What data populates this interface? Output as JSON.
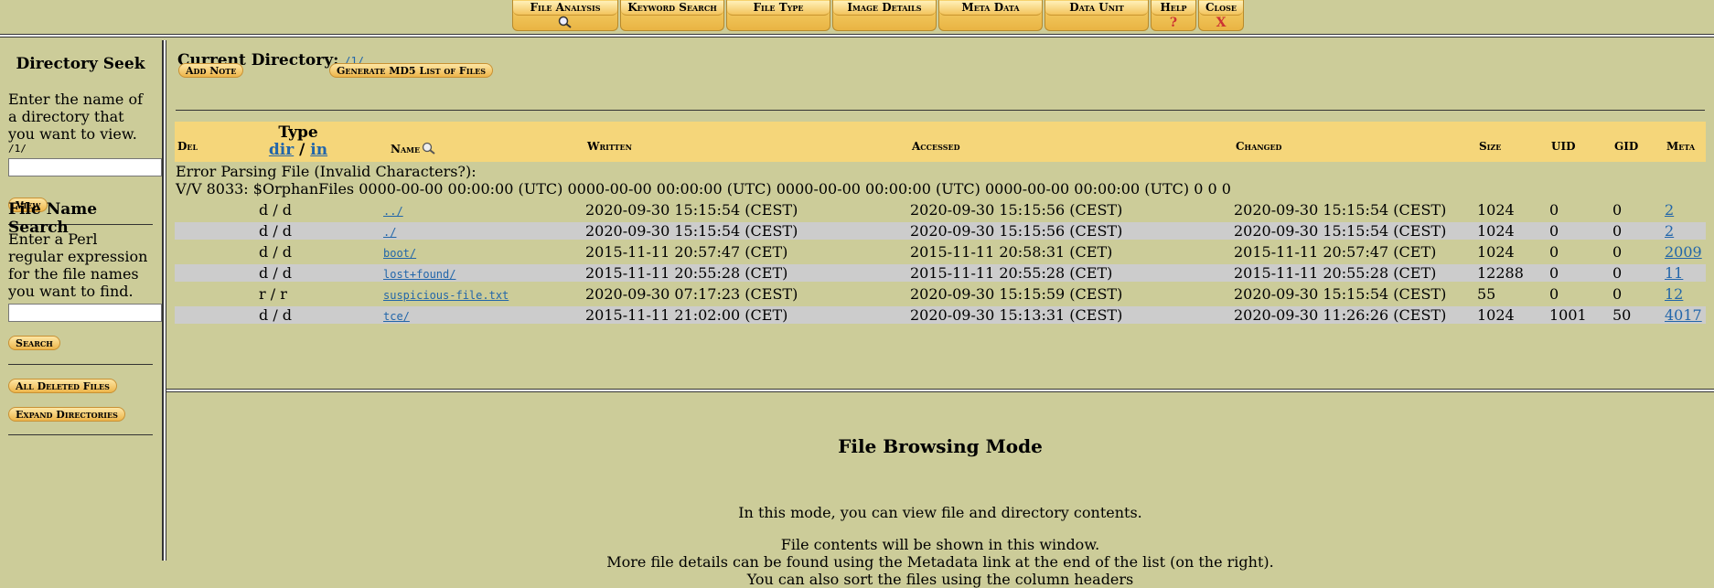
{
  "topbar": {
    "tabs": [
      {
        "label": "File Analysis",
        "icon": "magnifier-icon",
        "icon_glyph": "🔍"
      },
      {
        "label": "Keyword Search"
      },
      {
        "label": "File Type"
      },
      {
        "label": "Image Details"
      },
      {
        "label": "Meta Data"
      },
      {
        "label": "Data Unit"
      },
      {
        "label": "Help",
        "sub": "?"
      },
      {
        "label": "Close",
        "sub": "X"
      }
    ]
  },
  "left": {
    "dir_seek_title": "Directory Seek",
    "dir_seek_desc": "Enter the name of a directory that you want to view.",
    "dir_seek_current": "/1/",
    "view_button": "View",
    "name_search_title": "File Name Search",
    "name_search_desc": "Enter a Perl regular expression for the file names you want to find.",
    "search_button": "Search",
    "all_deleted_button": "All Deleted Files",
    "expand_dirs_button": "Expand Directories"
  },
  "main": {
    "current_dir_label": "Current Directory:",
    "current_dir_link": "/1/",
    "add_note_button": "Add Note",
    "md5_button": "Generate MD5 List of Files",
    "headers": {
      "del": "Del",
      "type": "Type",
      "type_dir": "dir",
      "type_sep": "/",
      "type_in": "in",
      "name": "Name",
      "written": "Written",
      "accessed": "Accessed",
      "changed": "Changed",
      "size": "Size",
      "uid": "UID",
      "gid": "GID",
      "meta": "Meta"
    },
    "error_line1": "Error Parsing File (Invalid Characters?):",
    "error_line2": "V/V 8033: $OrphanFiles 0000-00-00 00:00:00 (UTC) 0000-00-00 00:00:00 (UTC) 0000-00-00 00:00:00 (UTC) 0000-00-00 00:00:00 (UTC) 0 0 0",
    "rows": [
      {
        "type": "d / d",
        "name": "../",
        "written": "2020-09-30 15:15:54  (CEST)",
        "accessed": "2020-09-30 15:15:56  (CEST)",
        "changed": "2020-09-30 15:15:54  (CEST)",
        "size": "1024",
        "uid": "0",
        "gid": "0",
        "meta": "2"
      },
      {
        "type": "d / d",
        "name": "./",
        "written": "2020-09-30 15:15:54  (CEST)",
        "accessed": "2020-09-30 15:15:56  (CEST)",
        "changed": "2020-09-30 15:15:54  (CEST)",
        "size": "1024",
        "uid": "0",
        "gid": "0",
        "meta": "2"
      },
      {
        "type": "d / d",
        "name": "boot/",
        "written": "2015-11-11 20:57:47  (CET)",
        "accessed": "2015-11-11 20:58:31  (CET)",
        "changed": "2015-11-11 20:57:47  (CET)",
        "size": "1024",
        "uid": "0",
        "gid": "0",
        "meta": "2009"
      },
      {
        "type": "d / d",
        "name": "lost+found/",
        "written": "2015-11-11 20:55:28  (CET)",
        "accessed": "2015-11-11 20:55:28  (CET)",
        "changed": "2015-11-11 20:55:28  (CET)",
        "size": "12288",
        "uid": "0",
        "gid": "0",
        "meta": "11"
      },
      {
        "type": "r / r",
        "name": "suspicious-file.txt",
        "written": "2020-09-30 07:17:23  (CEST)",
        "accessed": "2020-09-30 15:15:59  (CEST)",
        "changed": "2020-09-30 15:15:54  (CEST)",
        "size": "55",
        "uid": "0",
        "gid": "0",
        "meta": "12"
      },
      {
        "type": "d / d",
        "name": "tce/",
        "written": "2015-11-11 21:02:00  (CET)",
        "accessed": "2020-09-30 15:13:31  (CEST)",
        "changed": "2020-09-30 11:26:26  (CEST)",
        "size": "1024",
        "uid": "1001",
        "gid": "50",
        "meta": "4017"
      }
    ]
  },
  "info": {
    "title": "File Browsing Mode",
    "p1": "In this mode, you can view file and directory contents.",
    "p2": "File contents will be shown in this window.",
    "p3": "More file details can be found using the Metadata link at the end of the list (on the right).",
    "p4": "You can also sort the files using the column headers"
  },
  "colors": {
    "background": "#cccc99",
    "header_row": "#f5d67a",
    "alt_row": "#cccccc",
    "link": "#2266aa",
    "button_gold": "#edb54a"
  }
}
